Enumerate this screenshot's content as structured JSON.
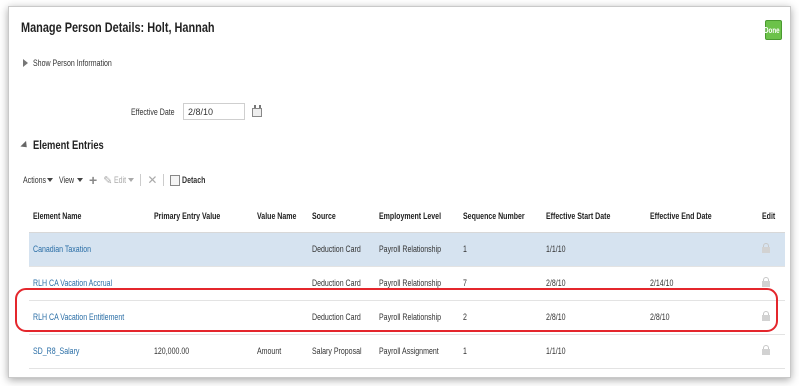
{
  "page": {
    "title": "Manage Person Details: Holt, Hannah",
    "done_label": "Done",
    "show_person_info": "Show Person Information"
  },
  "effective_date": {
    "label": "Effective Date",
    "value": "2/8/10"
  },
  "section": {
    "title": "Element Entries"
  },
  "toolbar": {
    "actions_label": "Actions",
    "view_label": "View",
    "edit_label": "Edit",
    "detach_label": "Detach"
  },
  "table": {
    "columns": [
      "Element Name",
      "Primary Entry Value",
      "Value Name",
      "Source",
      "Employment Level",
      "Sequence Number",
      "Effective Start Date",
      "Effective End Date",
      "Edit"
    ],
    "rows": [
      {
        "element_name": "Canadian Taxation",
        "primary_entry_value": "",
        "value_name": "",
        "source": "Deduction Card",
        "employment_level": "Payroll Relationship",
        "sequence_number": "1",
        "effective_start_date": "1/1/10",
        "effective_end_date": "",
        "selected": true
      },
      {
        "element_name": "RLH CA Vacation Accrual",
        "primary_entry_value": "",
        "value_name": "",
        "source": "Deduction Card",
        "employment_level": "Payroll Relationship",
        "sequence_number": "7",
        "effective_start_date": "2/8/10",
        "effective_end_date": "2/14/10",
        "selected": false
      },
      {
        "element_name": "RLH CA Vacation Entitlement",
        "primary_entry_value": "",
        "value_name": "",
        "source": "Deduction Card",
        "employment_level": "Payroll Relationship",
        "sequence_number": "2",
        "effective_start_date": "2/8/10",
        "effective_end_date": "2/8/10",
        "selected": false
      },
      {
        "element_name": "SD_R8_Salary",
        "primary_entry_value": "120,000.00",
        "value_name": "Amount",
        "source": "Salary Proposal",
        "employment_level": "Payroll Assignment",
        "sequence_number": "1",
        "effective_start_date": "1/1/10",
        "effective_end_date": "",
        "selected": false
      }
    ]
  },
  "colors": {
    "done": "#6cc24a",
    "link": "#2a6ea6",
    "selected_row": "#d6e3f0",
    "highlight": "#e4262c"
  },
  "icons": [
    "calendar-icon",
    "add-icon",
    "edit-icon",
    "delete-icon",
    "detach-icon",
    "lock-icon"
  ]
}
